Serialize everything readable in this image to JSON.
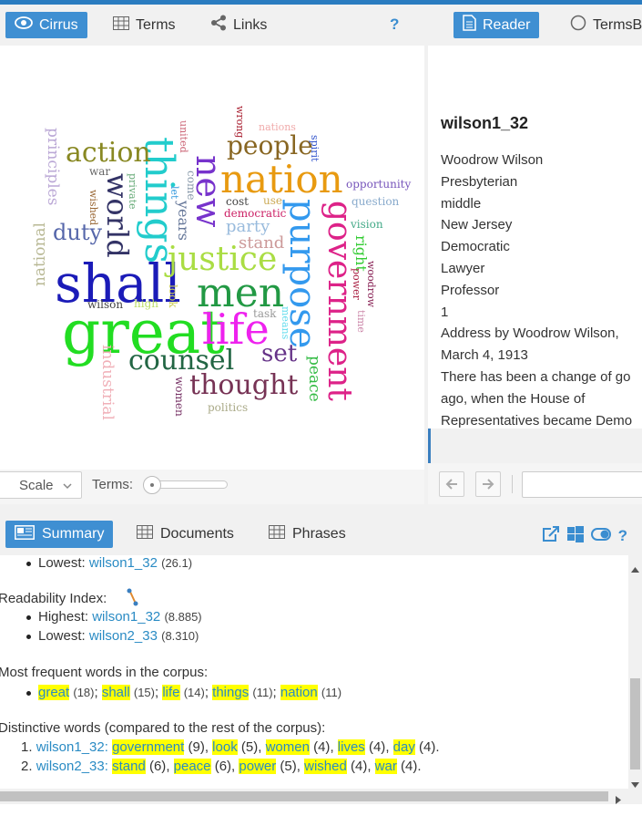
{
  "top_tabs": {
    "cirrus": "Cirrus",
    "terms": "Terms",
    "links": "Links",
    "help": "?",
    "reader": "Reader",
    "termsberry": "TermsB"
  },
  "cirrus": {
    "words": [
      "shall",
      "great",
      "nation",
      "life",
      "men",
      "things",
      "purpose",
      "government",
      "justice",
      "new",
      "action",
      "people",
      "world",
      "counsel",
      "thought",
      "duty",
      "set",
      "peace",
      "industrial",
      "principles",
      "national",
      "years",
      "party",
      "stand",
      "right",
      "come",
      "opportunity",
      "question",
      "vision",
      "democratic",
      "cost",
      "use",
      "power",
      "woodrow",
      "time",
      "means",
      "task",
      "look",
      "high",
      "wilson",
      "women",
      "politics",
      "private",
      "wished",
      "war",
      "let",
      "spirit",
      "nations",
      "united",
      "wrong"
    ],
    "scale_label": "Scale",
    "terms_label": "Terms:"
  },
  "reader": {
    "doc_title": "wilson1_32",
    "lines": [
      "Woodrow Wilson",
      "Presbyterian",
      "middle",
      "New Jersey",
      "Democratic",
      "Lawyer",
      "Professor",
      "1",
      "Address by Woodrow Wilson,",
      "March 4, 1913",
      "There has been a change of go",
      "ago, when the House of",
      "Representatives became Demo"
    ]
  },
  "bottom_tabs": {
    "summary": "Summary",
    "documents": "Documents",
    "phrases": "Phrases",
    "help": "?"
  },
  "summary": {
    "lowest_label": "Lowest: ",
    "lowest_doc": "wilson1_32",
    "lowest_val": "(26.1)",
    "readability_label": "Readability Index:",
    "highest_label": "Highest: ",
    "highest_doc": "wilson1_32",
    "highest_val": "(8.885)",
    "lowest2_label": "Lowest: ",
    "lowest2_doc": "wilson2_33",
    "lowest2_val": "(8.310)",
    "frequent_label": "Most frequent words in the corpus:",
    "frequent": [
      {
        "word": "great",
        "count": "(18)"
      },
      {
        "word": "shall",
        "count": "(15)"
      },
      {
        "word": "life",
        "count": "(14)"
      },
      {
        "word": "things",
        "count": "(11)"
      },
      {
        "word": "nation",
        "count": "(11)"
      }
    ],
    "distinctive_label": "Distinctive words (compared to the rest of the corpus):",
    "distinctive": [
      {
        "num": "1.",
        "doc": "wilson1_32",
        "words": [
          {
            "word": "government",
            "count": "(9)"
          },
          {
            "word": "look",
            "count": "(5)"
          },
          {
            "word": "women",
            "count": "(4)"
          },
          {
            "word": "lives",
            "count": "(4)"
          },
          {
            "word": "day",
            "count": "(4)"
          }
        ]
      },
      {
        "num": "2.",
        "doc": "wilson2_33",
        "words": [
          {
            "word": "stand",
            "count": "(6)"
          },
          {
            "word": "peace",
            "count": "(6)"
          },
          {
            "word": "power",
            "count": "(5)"
          },
          {
            "word": "wished",
            "count": "(4)"
          },
          {
            "word": "war",
            "count": "(4)"
          }
        ]
      }
    ]
  },
  "colors": {
    "accent": "#3f8fd2",
    "link": "#2a8bc4",
    "highlight": "#ffff00"
  }
}
